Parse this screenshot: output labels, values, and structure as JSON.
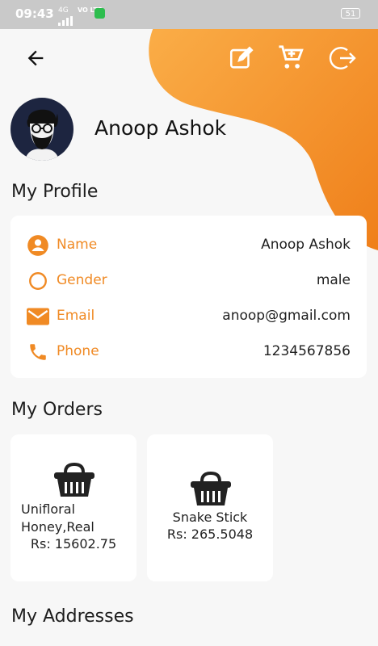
{
  "status_bar": {
    "time": "09:43",
    "network": "4G",
    "volte": "VO LTE",
    "battery": "51"
  },
  "header": {
    "back_icon": "arrow-left-icon",
    "actions": [
      "edit-note-icon",
      "add-to-cart-icon",
      "logout-icon"
    ]
  },
  "user": {
    "name": "Anoop Ashok",
    "avatar": "man-with-glasses-and-beard-avatar"
  },
  "profile": {
    "title": "My Profile",
    "rows": [
      {
        "icon": "account-circle-icon",
        "label": "Name",
        "value": "Anoop Ashok"
      },
      {
        "icon": "circle-outline-icon",
        "label": "Gender",
        "value": "male"
      },
      {
        "icon": "email-icon",
        "label": "Email",
        "value": "anoop@gmail.com"
      },
      {
        "icon": "phone-icon",
        "label": "Phone",
        "value": "1234567856"
      }
    ]
  },
  "orders": {
    "title": "My Orders",
    "items": [
      {
        "name": "Unifloral Honey,Real",
        "price": "Rs: 15602.75"
      },
      {
        "name": "Snake Stick",
        "price": "Rs: 265.5048"
      }
    ]
  },
  "addresses": {
    "title": "My Addresses"
  },
  "colors": {
    "accent": "#f08a24",
    "accent_light": "#fbb04a",
    "avatar_bg": "#1d2540",
    "card_bg": "#ffffff",
    "page_bg": "#f7f7f7"
  }
}
